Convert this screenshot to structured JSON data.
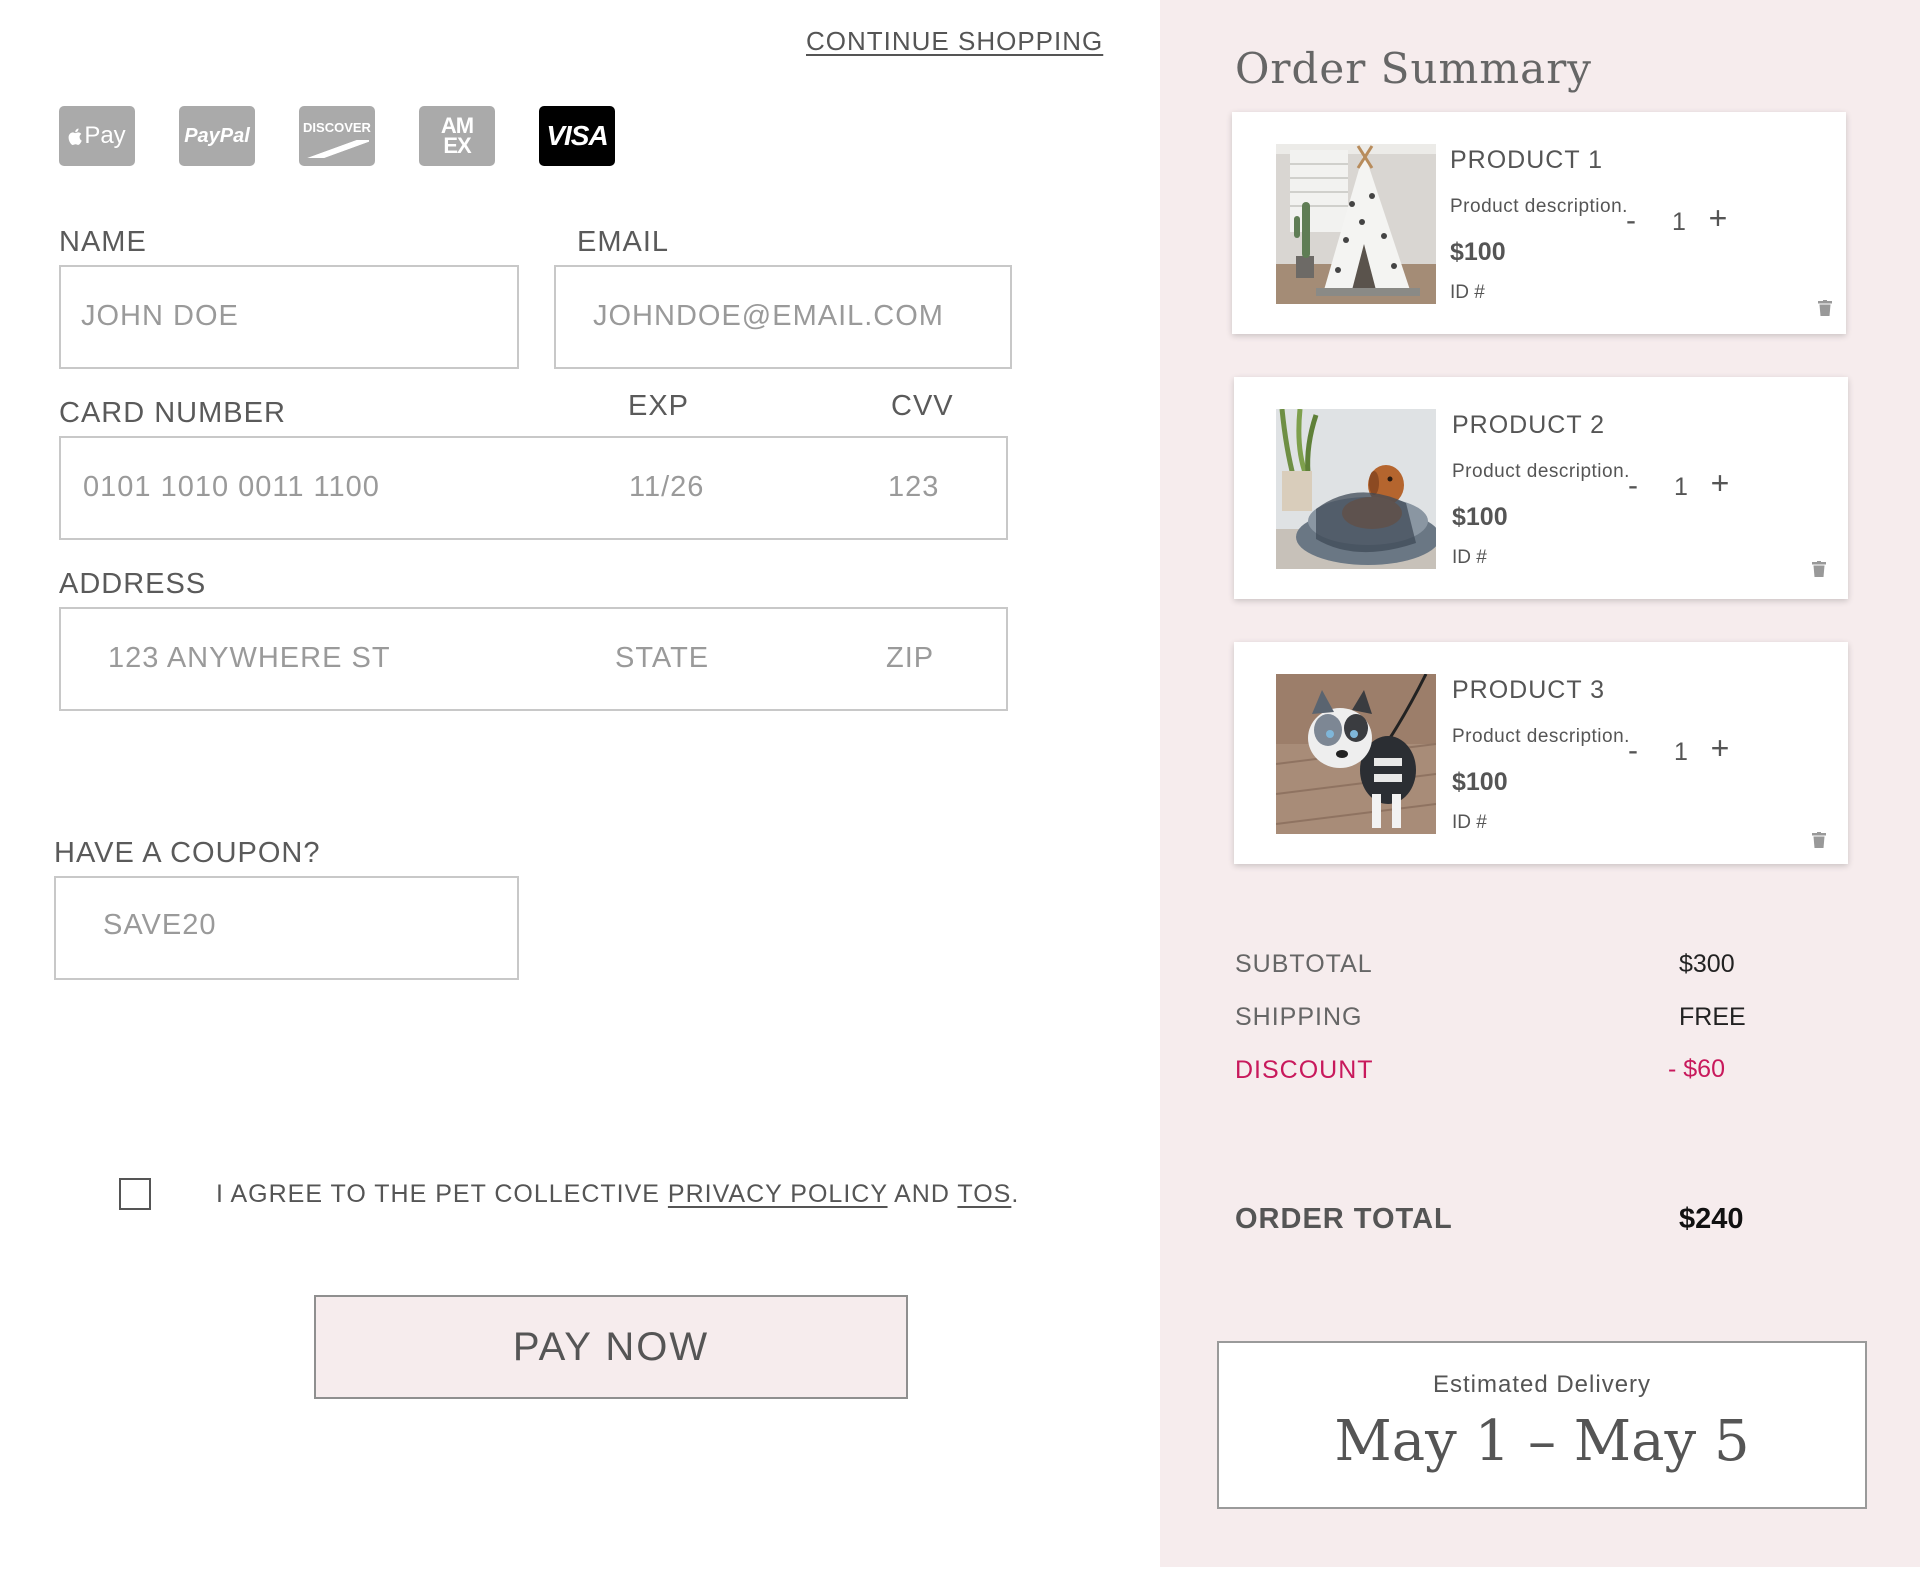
{
  "header": {
    "continue_shopping": "CONTINUE SHOPPING"
  },
  "payment_methods": [
    {
      "name": "apple-pay",
      "label": "Pay",
      "color": "#aaaaaa"
    },
    {
      "name": "paypal",
      "label": "PayPal",
      "color": "#aaaaaa"
    },
    {
      "name": "discover",
      "label": "DISCOVER",
      "color": "#aaaaaa"
    },
    {
      "name": "amex",
      "label_top": "AM",
      "label_bottom": "EX",
      "color": "#aaaaaa"
    },
    {
      "name": "visa",
      "label": "VISA",
      "color": "#000000",
      "selected": true
    }
  ],
  "form": {
    "name": {
      "label": "NAME",
      "value": "JOHN DOE"
    },
    "email": {
      "label": "EMAIL",
      "value": "JOHNDOE@EMAIL.COM"
    },
    "card": {
      "label": "CARD NUMBER",
      "value": "0101 1010 0011 1100",
      "exp_label": "EXP",
      "exp_value": "11/26",
      "cvv_label": "CVV",
      "cvv_value": "123"
    },
    "address": {
      "label": "ADDRESS",
      "street": "123 ANYWHERE ST",
      "state": "STATE",
      "zip": "ZIP"
    },
    "coupon": {
      "label": "HAVE A COUPON?",
      "value": "SAVE20"
    },
    "agree": {
      "prefix": "I AGREE TO THE PET COLLECTIVE ",
      "privacy": "PRIVACY POLICY",
      "and": " AND ",
      "tos": "TOS",
      "suffix": ".",
      "checked": false
    },
    "pay_button": "PAY NOW"
  },
  "summary": {
    "title": "Order Summary",
    "products": [
      {
        "name": "PRODUCT 1",
        "description": "Product description.",
        "price": "$100",
        "id_label": "ID #",
        "qty": "1",
        "qty_minus": "-",
        "qty_plus": "+"
      },
      {
        "name": "PRODUCT 2",
        "description": "Product description.",
        "price": "$100",
        "id_label": "ID #",
        "qty": "1",
        "qty_minus": "-",
        "qty_plus": "+"
      },
      {
        "name": "PRODUCT 3",
        "description": "Product description.",
        "price": "$100",
        "id_label": "ID #",
        "qty": "1",
        "qty_minus": "-",
        "qty_plus": "+"
      }
    ],
    "subtotal_label": "SUBTOTAL",
    "subtotal_value": "$300",
    "shipping_label": "SHIPPING",
    "shipping_value": "FREE",
    "discount_label": "DISCOUNT",
    "discount_value": "- $60",
    "total_label": "ORDER TOTAL",
    "total_value": "$240",
    "delivery_label": "Estimated Delivery",
    "delivery_dates": "May 1 – May 5"
  },
  "colors": {
    "summary_bg": "#f6eced",
    "discount": "#c8195c",
    "pay_button_bg": "#f6eced"
  }
}
